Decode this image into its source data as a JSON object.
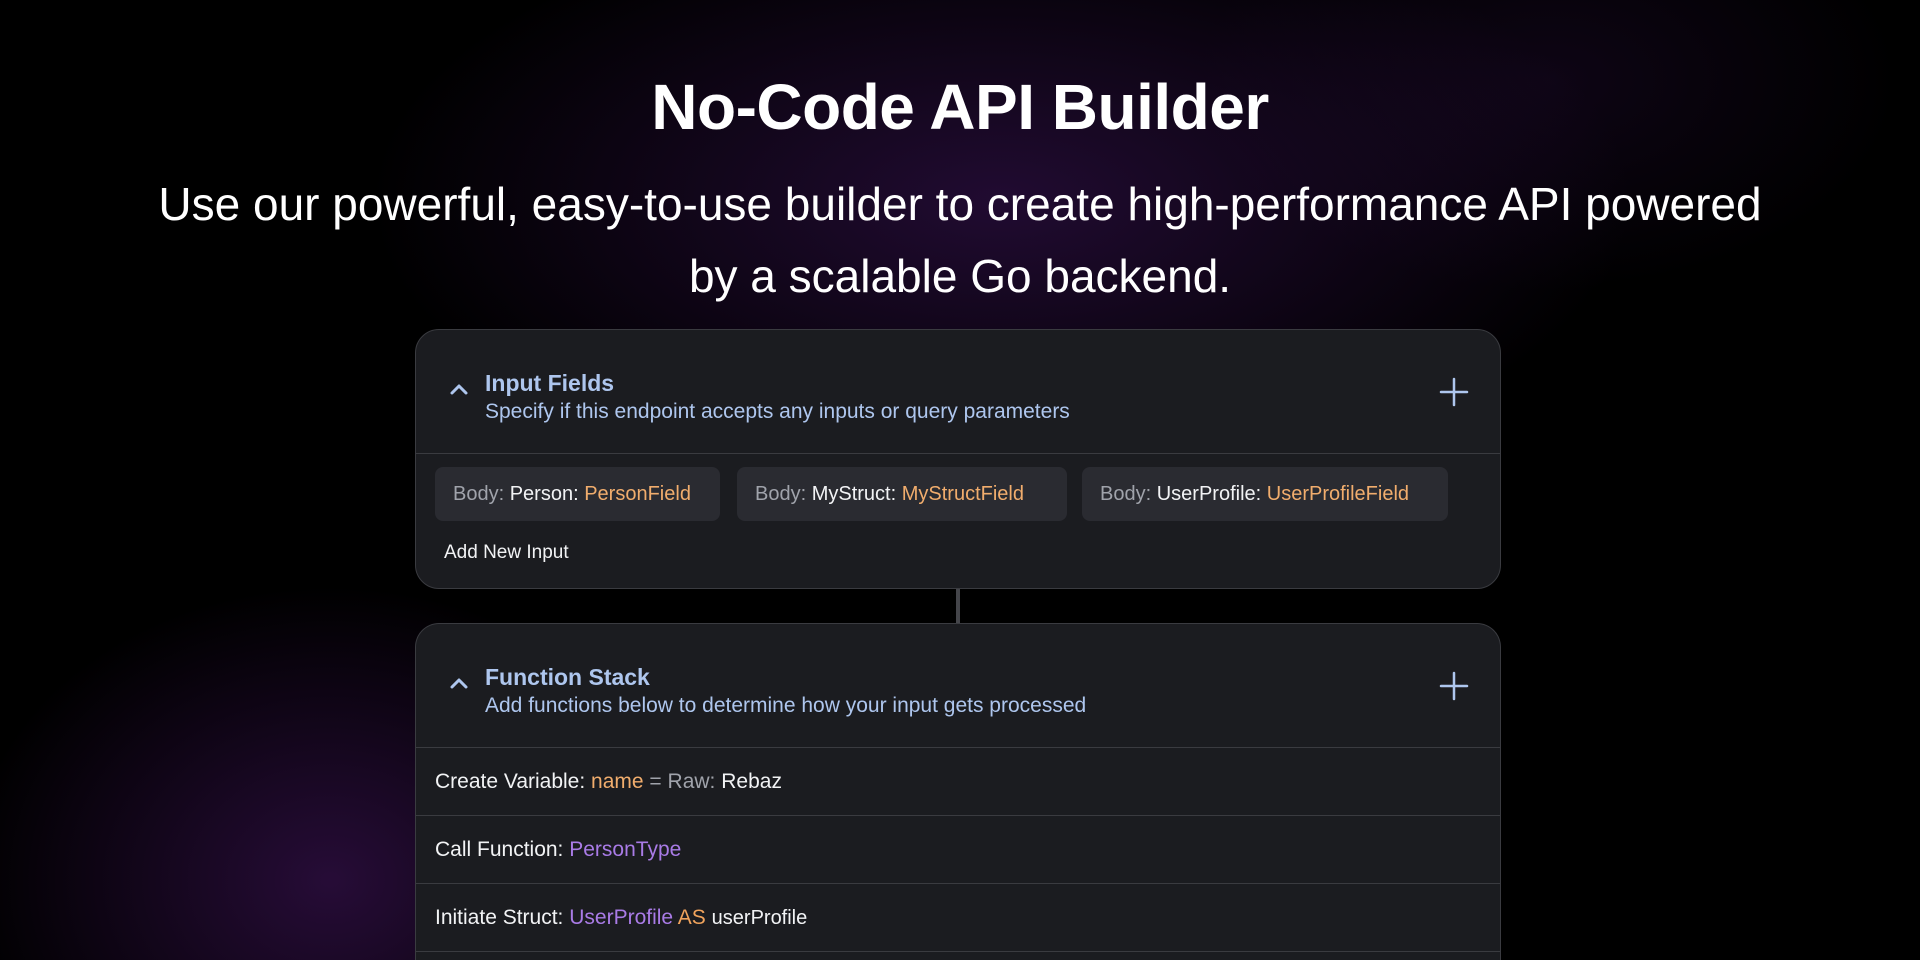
{
  "hero": {
    "title": "No-Code API Builder",
    "subtitle": "Use our powerful, easy-to-use builder to create high-performance API powered by a scalable Go backend."
  },
  "input_fields": {
    "title": "Input Fields",
    "description": "Specify if this endpoint accepts any inputs or query parameters",
    "chips": [
      {
        "prefix": "Body:",
        "type": "Person:",
        "field": "PersonField"
      },
      {
        "prefix": "Body:",
        "type": "MyStruct:",
        "field": "MyStructField"
      },
      {
        "prefix": "Body:",
        "type": "UserProfile:",
        "field": "UserProfileField"
      }
    ],
    "add_label": "Add New Input",
    "icons": {
      "collapse": "chevron-up-icon",
      "add": "plus-icon"
    }
  },
  "function_stack": {
    "title": "Function Stack",
    "description": "Add functions below to determine how your input gets processed",
    "rows": [
      {
        "label": "Create Variable:",
        "var": "name",
        "eq": "=",
        "raw": "Raw:",
        "value": "Rebaz"
      },
      {
        "label": "Call Function:",
        "func": "PersonType"
      },
      {
        "label": "Initiate Struct:",
        "struct": "UserProfile",
        "as": "AS",
        "alias": "userProfile"
      }
    ],
    "icons": {
      "collapse": "chevron-up-icon",
      "add": "plus-icon"
    }
  },
  "colors": {
    "accent_blue": "#aec6ee",
    "orange": "#f1ad6d",
    "purple": "#a97be6",
    "card_bg": "#1b1c20",
    "chip_bg": "#2a2b31"
  }
}
